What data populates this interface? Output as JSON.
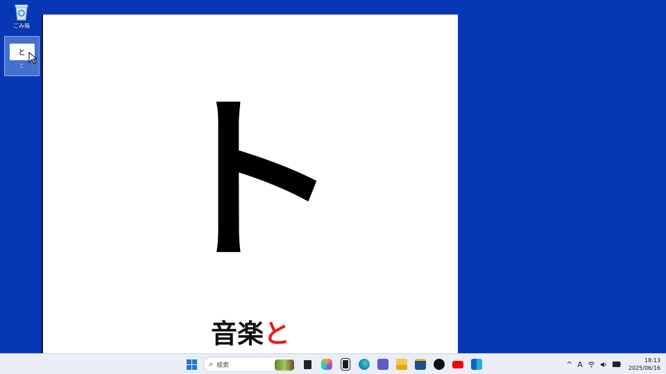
{
  "desktop": {
    "icons": [
      {
        "label": "ごみ箱"
      },
      {
        "label": "と",
        "thumb_text": "と"
      }
    ]
  },
  "viewer": {
    "kana": "ト",
    "caption_prefix": "音楽",
    "caption_highlight": "と"
  },
  "taskbar": {
    "search_placeholder": "検索",
    "clock_time": "18:13",
    "clock_date": "2025/06/16",
    "ime_label": "A"
  },
  "colors": {
    "desktop_bg": "#0837b6",
    "caption_highlight": "#e0201e"
  }
}
